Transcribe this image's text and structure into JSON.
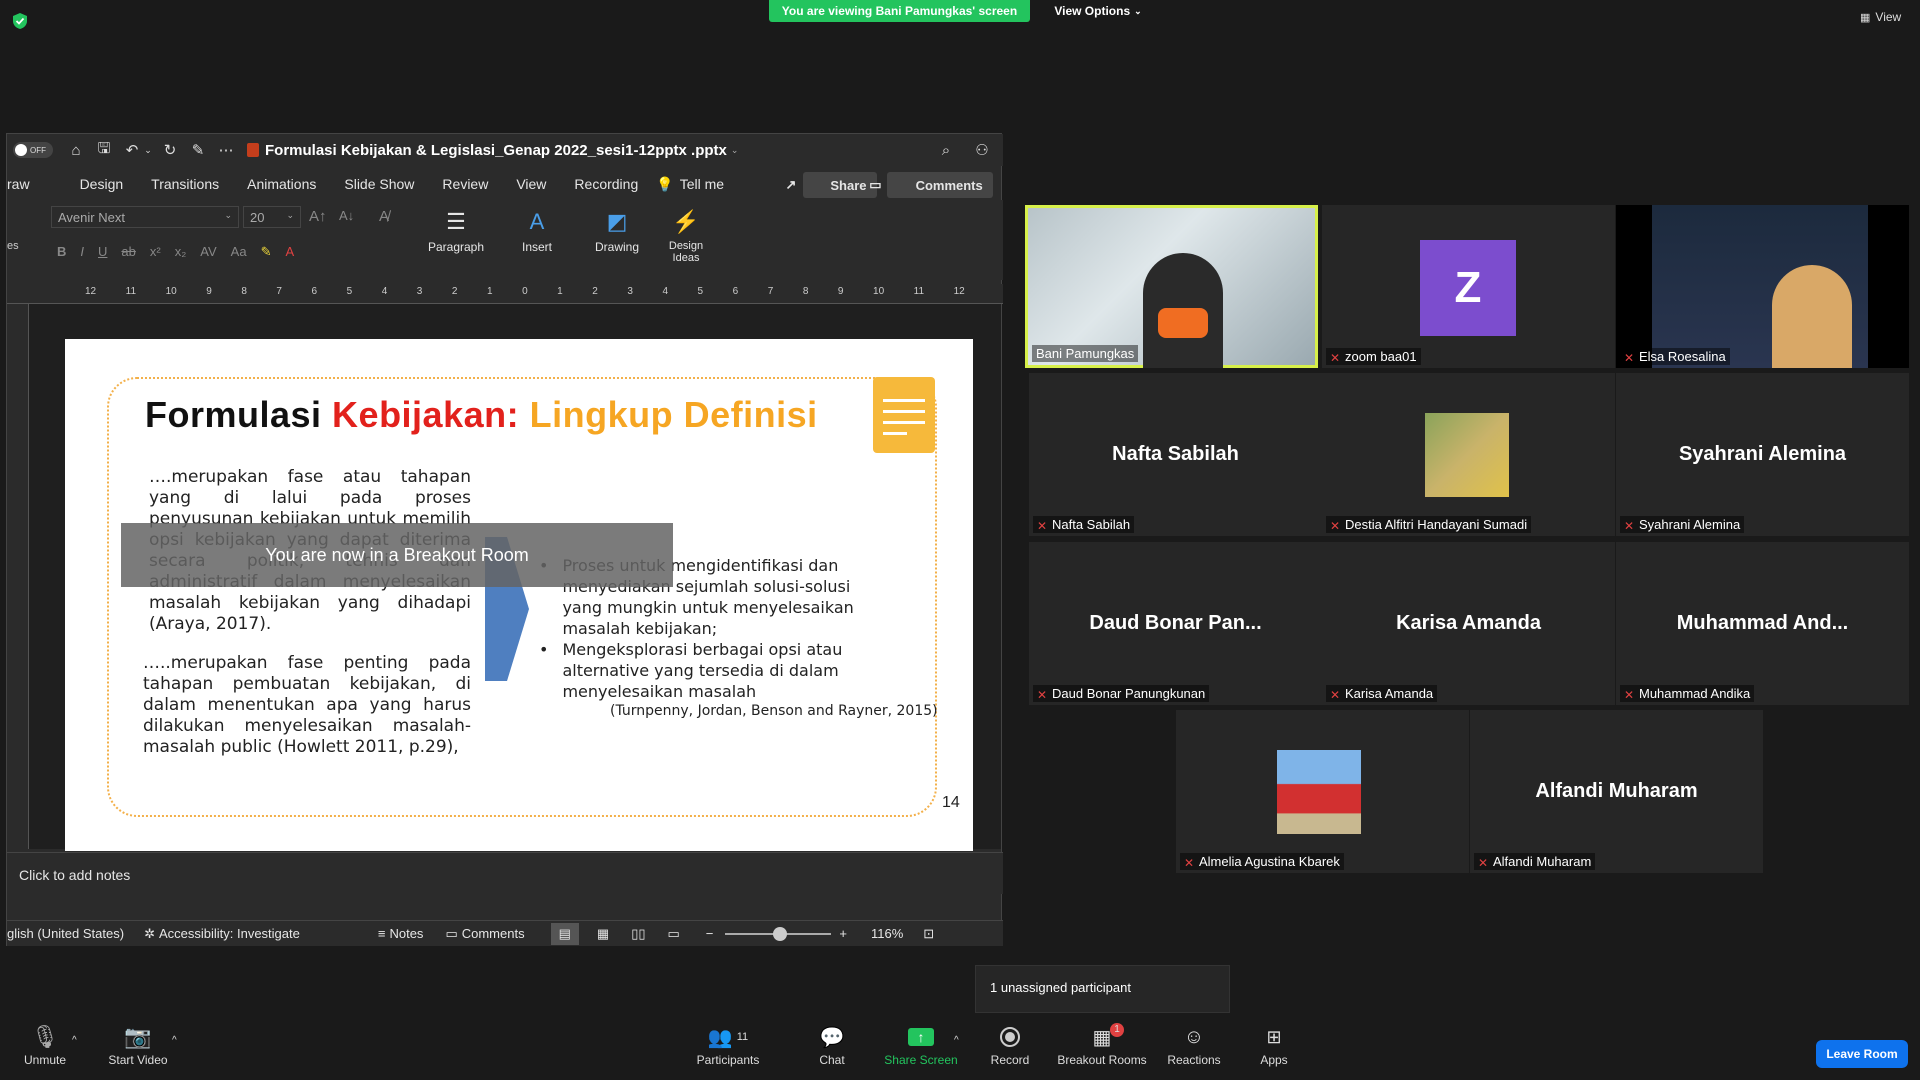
{
  "zoom": {
    "viewing_banner": "You are viewing Bani Pamungkas' screen",
    "view_options": "View Options",
    "view_label": "View",
    "breakout_toast": "You are now in a Breakout Room",
    "unassigned": "1 unassigned participant",
    "leave_room": "Leave Room",
    "participants_count": "11",
    "breakout_badge": "1",
    "toolbar": {
      "unmute": "Unmute",
      "start_video": "Start Video",
      "participants": "Participants",
      "chat": "Chat",
      "share_screen": "Share Screen",
      "record": "Record",
      "breakout_rooms": "Breakout Rooms",
      "reactions": "Reactions",
      "apps": "Apps"
    }
  },
  "ppt": {
    "toggle": "OFF",
    "file_title": "Formulasi Kebijakan & Legislasi_Genap 2022_sesi1-12pptx .pptx",
    "tabs": [
      "raw",
      "Design",
      "Transitions",
      "Animations",
      "Slide Show",
      "Review",
      "View",
      "Recording",
      "Tell me"
    ],
    "share": "Share",
    "comments_btn": "Comments",
    "font_name": "Avenir Next",
    "font_size": "20",
    "ribbon": {
      "paragraph": "Paragraph",
      "insert": "Insert",
      "drawing": "Drawing",
      "design_ideas": "Design Ideas",
      "side_label": "es"
    },
    "ruler_ticks": [
      "12",
      "11",
      "10",
      "9",
      "8",
      "7",
      "6",
      "5",
      "4",
      "3",
      "2",
      "1",
      "0",
      "1",
      "2",
      "3",
      "4",
      "5",
      "6",
      "7",
      "8",
      "9",
      "10",
      "11",
      "12"
    ],
    "notes_placeholder": "Click to add notes",
    "status": {
      "language": "glish (United States)",
      "accessibility": "Accessibility: Investigate",
      "notes": "Notes",
      "comments": "Comments",
      "zoom": "116%"
    },
    "slide": {
      "title_part1": "Formulasi ",
      "title_part2": "Kebijakan:",
      "title_part3": " Lingkup Definisi",
      "para1": "….merupakan fase atau tahapan yang di lalui pada proses penyusunan kebijakan untuk memilih opsi kebijakan yang dapat diterima secara politik, tehnis dan administratif dalam menyelesaikan masalah kebijakan yang dihadapi (Araya, 2017).",
      "para2": "…..merupakan fase penting pada tahapan pembuatan kebijakan, di dalam menentukan apa yang harus dilakukan menyelesaikan masalah-masalah public (Howlett 2011, p.29),",
      "bullet1": "Proses untuk mengidentifikasi dan menyediakan sejumlah solusi-solusi yang mungkin untuk menyelesaikan masalah kebijakan;",
      "bullet2": "Mengeksplorasi berbagai opsi atau alternative yang tersedia di dalam menyelesaikan masalah",
      "citation": "(Turnpenny, Jordan, Benson and Rayner, 2015)",
      "page_number": "14"
    }
  },
  "participants": [
    {
      "label": "Bani Pamungkas",
      "big": "",
      "type": "video"
    },
    {
      "label": "zoom baa01",
      "big": "Z",
      "type": "avatar"
    },
    {
      "label": "Elsa Roesalina",
      "big": "",
      "type": "video"
    },
    {
      "label": "Nafta Sabilah",
      "big": "Nafta Sabilah",
      "type": "name"
    },
    {
      "label": "Destia Alfitri Handayani Sumadi",
      "big": "",
      "type": "photo"
    },
    {
      "label": "Syahrani Alemina",
      "big": "Syahrani Alemina",
      "type": "name"
    },
    {
      "label": "Daud Bonar Panungkunan",
      "big": "Daud Bonar Pan...",
      "type": "name"
    },
    {
      "label": "Karisa Amanda",
      "big": "Karisa Amanda",
      "type": "name"
    },
    {
      "label": "Muhammad Andika",
      "big": "Muhammad And...",
      "type": "name"
    },
    {
      "label": "Almelia Agustina Kbarek",
      "big": "",
      "type": "photo"
    },
    {
      "label": "Alfandi Muharam",
      "big": "Alfandi Muharam",
      "type": "name"
    }
  ],
  "colors": {
    "banner_green": "#23c45e",
    "active_border": "#d7f04a",
    "title_red": "#e2211c",
    "title_orange": "#f6a623",
    "avatar_purple": "#7c4dce",
    "leave_blue": "#0e72ed",
    "mute_red": "#e04141"
  }
}
